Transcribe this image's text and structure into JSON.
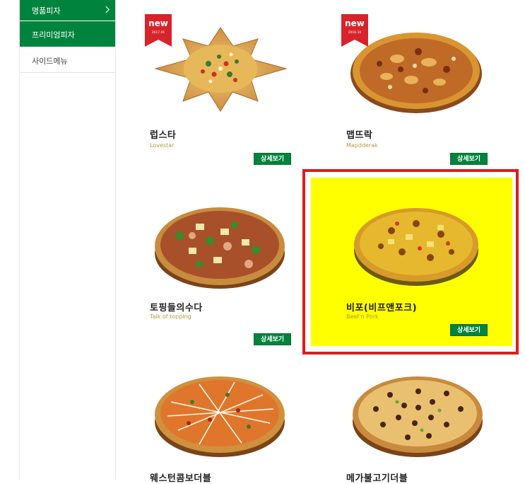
{
  "sidebar": {
    "items": [
      {
        "label": "명품피자",
        "state": "active"
      },
      {
        "label": "프리미엄피자",
        "state": "active"
      },
      {
        "label": "사이드메뉴",
        "state": "normal"
      }
    ]
  },
  "menu": {
    "detail_label": "상세보기",
    "new_badge": "new",
    "pizzas": [
      {
        "name": "럽스타",
        "eng": "Lovestar",
        "badge_date": "2017.01",
        "is_new": true
      },
      {
        "name": "맵뜨락",
        "eng": "Mapdderak",
        "badge_date": "2016.10",
        "is_new": true
      },
      {
        "name": "토핑들의수다",
        "eng": "Talk of topping",
        "is_new": false
      },
      {
        "name": "비포(비프앤포크)",
        "eng": "Beef n Pork",
        "is_new": false,
        "highlighted": true
      },
      {
        "name": "웨스턴콤보더블",
        "eng": "",
        "is_new": false
      },
      {
        "name": "메가불고기더블",
        "eng": "",
        "is_new": false
      }
    ]
  },
  "colors": {
    "brand_green": "#00843d",
    "highlight_border": "#e01b1b",
    "highlight_bg": "#ffff00",
    "badge_red": "#d8232a"
  }
}
